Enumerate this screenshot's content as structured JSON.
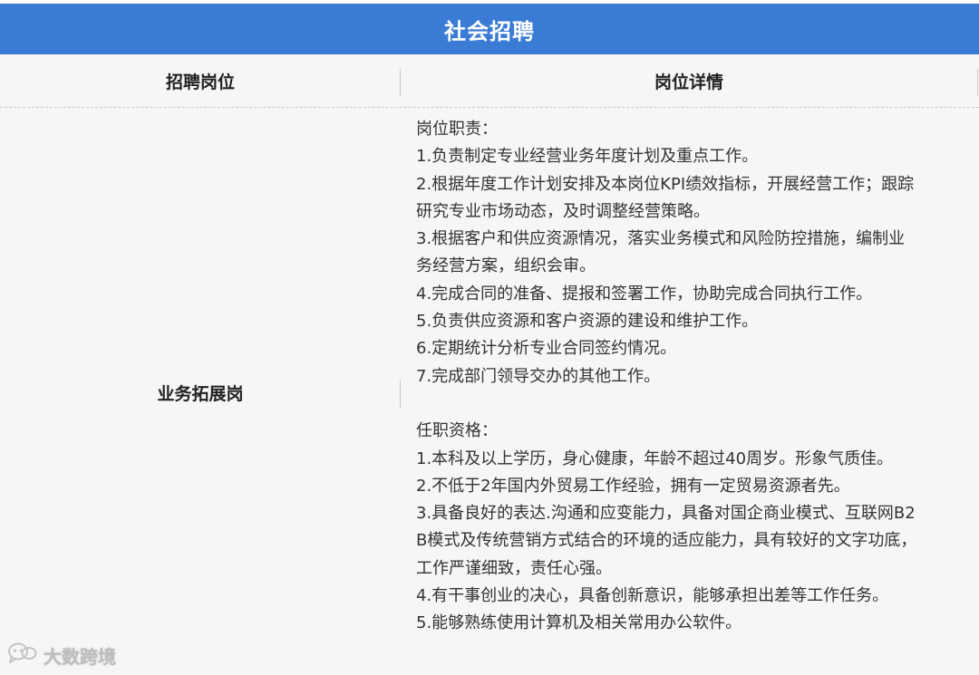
{
  "banner": {
    "title": "社会招聘"
  },
  "table": {
    "headers": {
      "position": "招聘岗位",
      "details": "岗位详情"
    },
    "row": {
      "position": "业务拓展岗",
      "responsibilities": {
        "heading": "岗位职责：",
        "items": [
          "1.负责制定专业经营业务年度计划及重点工作。",
          "2.根据年度工作计划安排及本岗位KPI绩效指标，开展经营工作；跟踪",
          "研究专业市场动态，及时调整经营策略。",
          "3.根据客户和供应资源情况，落实业务模式和风险防控措施，编制业",
          "务经营方案，组织会审。",
          "4.完成合同的准备、提报和签署工作，协助完成合同执行工作。",
          "5.负责供应资源和客户资源的建设和维护工作。",
          "6.定期统计分析专业合同签约情况。",
          "7.完成部门领导交办的其他工作。"
        ]
      },
      "qualifications": {
        "heading": "任职资格：",
        "items": [
          "1.本科及以上学历，身心健康，年龄不超过40周岁。形象气质佳。",
          "2.不低于2年国内外贸易工作经验，拥有一定贸易资源者先。",
          "3.具备良好的表达.沟通和应变能力，具备对国企商业模式、互联网B2",
          "B模式及传统营销方式结合的环境的适应能力，具有较好的文字功底，",
          "工作严谨细致，责任心强。",
          "4.有干事创业的决心，具备创新意识，能够承担出差等工作任务。",
          "5.能够熟练使用计算机及相关常用办公软件。"
        ]
      }
    }
  },
  "watermark": {
    "text": "大数跨境",
    "icon": "wechat-logo-icon"
  },
  "colors": {
    "banner": "#3a7bd5",
    "table_bg": "#f6f6f6"
  }
}
